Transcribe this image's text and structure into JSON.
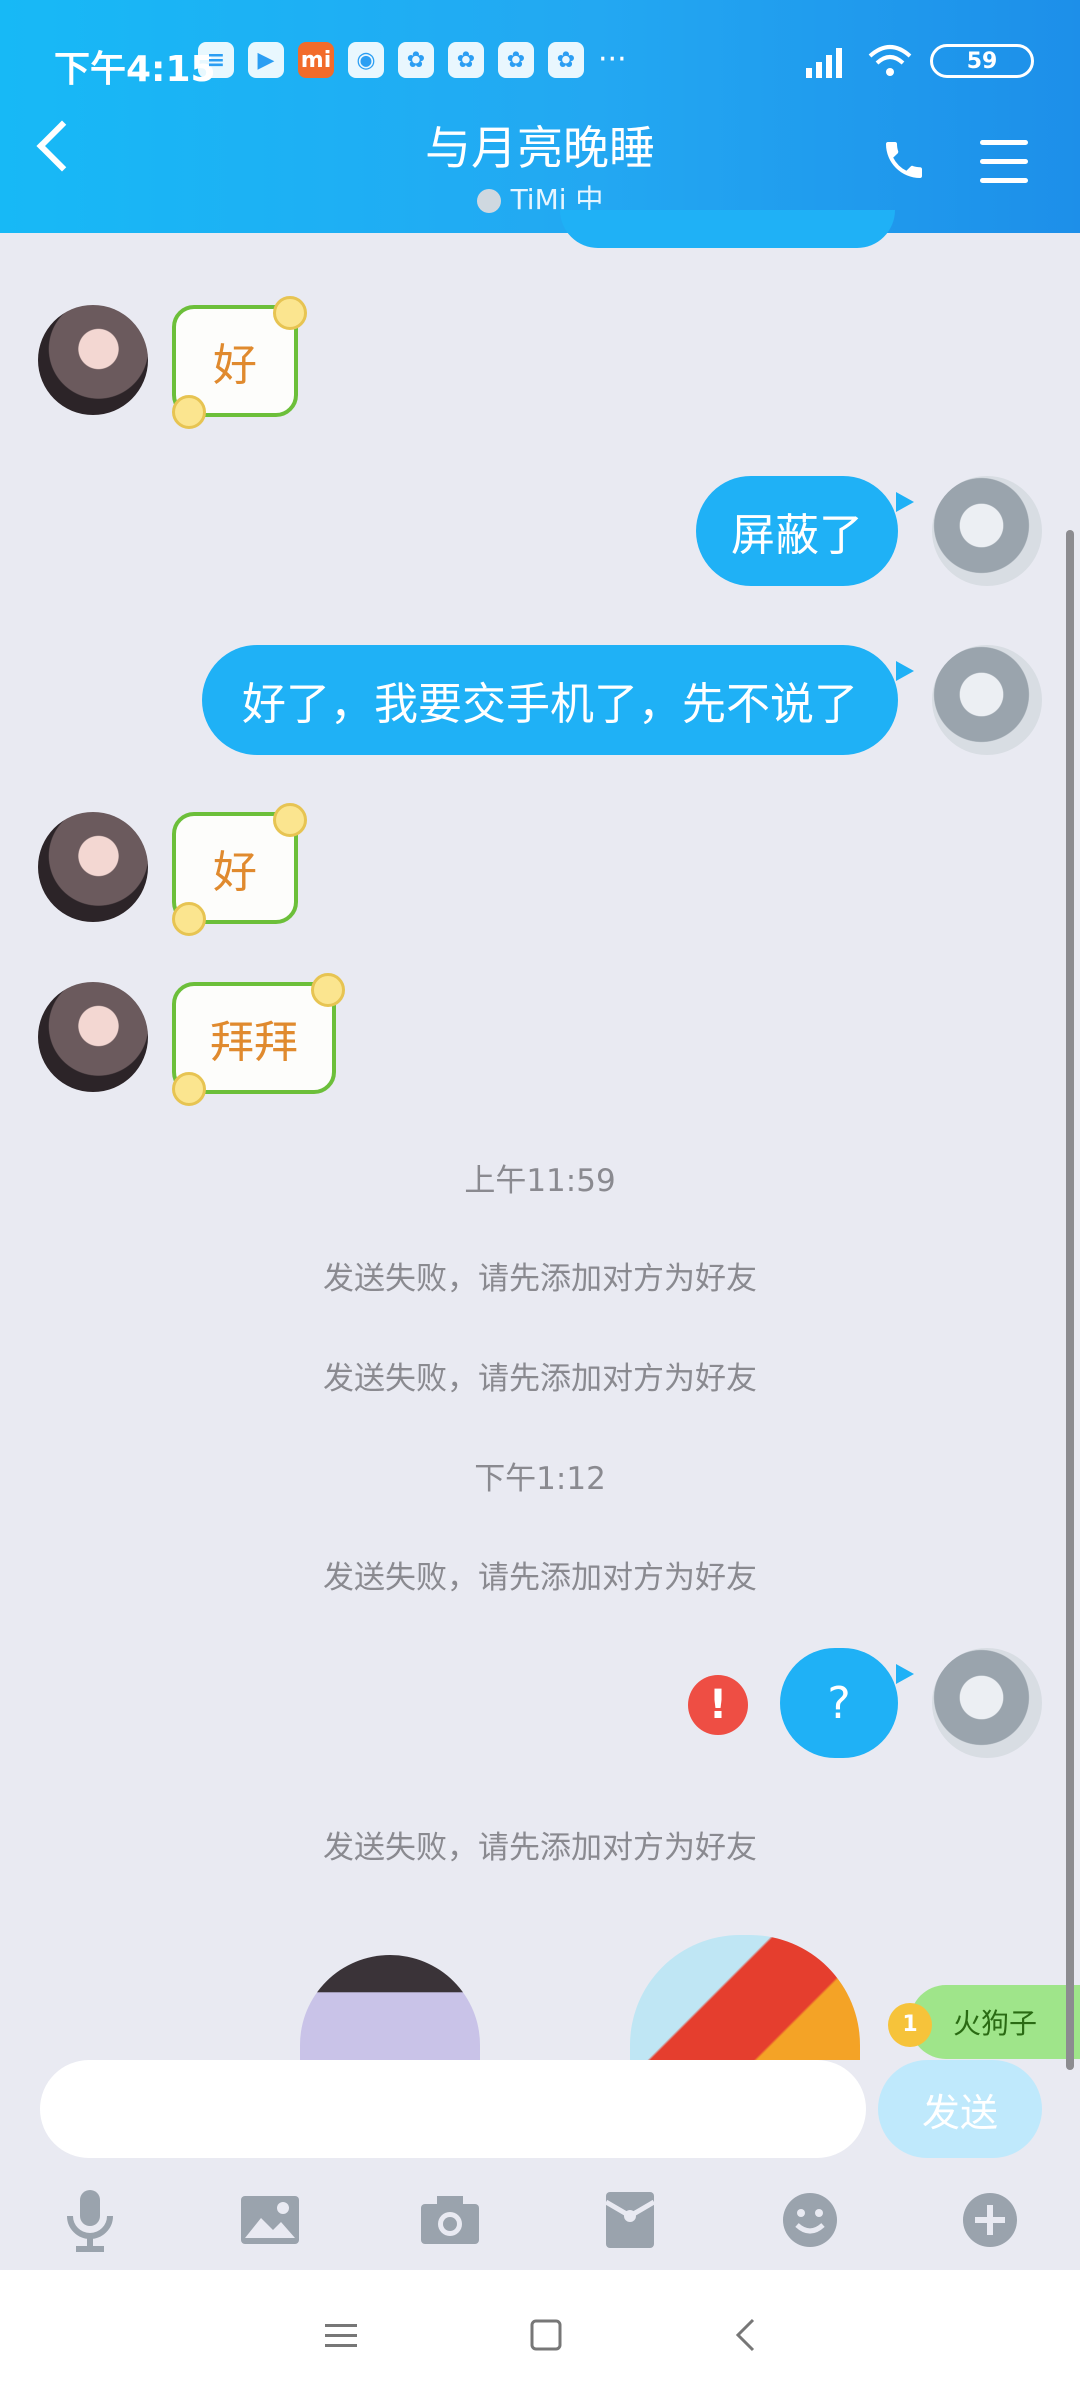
{
  "status_bar": {
    "time": "下午4:15",
    "battery": "59",
    "app_icons": [
      "messages-icon",
      "play-store-icon",
      "mi-icon",
      "game-icon",
      "baidu-paw-icon",
      "baidu-paw-icon",
      "baidu-paw-icon",
      "baidu-paw-icon"
    ],
    "more": "···"
  },
  "header": {
    "title": "与月亮晚睡",
    "subtitle": "TiMi 中"
  },
  "messages": [
    {
      "side": "left",
      "type": "sticker",
      "text": "好"
    },
    {
      "side": "right",
      "type": "text",
      "text": "屏蔽了"
    },
    {
      "side": "right",
      "type": "text",
      "text": "好了，我要交手机了，先不说了"
    },
    {
      "side": "left",
      "type": "sticker",
      "text": "好"
    },
    {
      "side": "left",
      "type": "sticker",
      "text": "拜拜"
    },
    {
      "side": "system",
      "type": "time",
      "text": "上午11:59"
    },
    {
      "side": "system",
      "type": "notice",
      "text": "发送失败，请先添加对方为好友"
    },
    {
      "side": "system",
      "type": "notice",
      "text": "发送失败，请先添加对方为好友"
    },
    {
      "side": "system",
      "type": "time",
      "text": "下午1:12"
    },
    {
      "side": "system",
      "type": "notice",
      "text": "发送失败，请先添加对方为好友"
    },
    {
      "side": "right",
      "type": "text",
      "text": "?"
    },
    {
      "side": "system",
      "type": "notice",
      "text": "发送失败，请先添加对方为好友"
    }
  ],
  "error_mark": "!",
  "sticker_suggestion": {
    "label": "火狗子",
    "badge": "1"
  },
  "input": {
    "placeholder": "",
    "value": ""
  },
  "send_label": "发送",
  "toolbar": [
    "microphone-icon",
    "image-icon",
    "camera-icon",
    "red-packet-icon",
    "emoji-icon",
    "plus-icon"
  ],
  "nav": [
    "menu-icon",
    "home-icon",
    "back-icon"
  ],
  "colors": {
    "header": "#1fb1f6",
    "bubble": "#1fb1f6",
    "background": "#e9eaf2",
    "error": "#ee4e44"
  }
}
